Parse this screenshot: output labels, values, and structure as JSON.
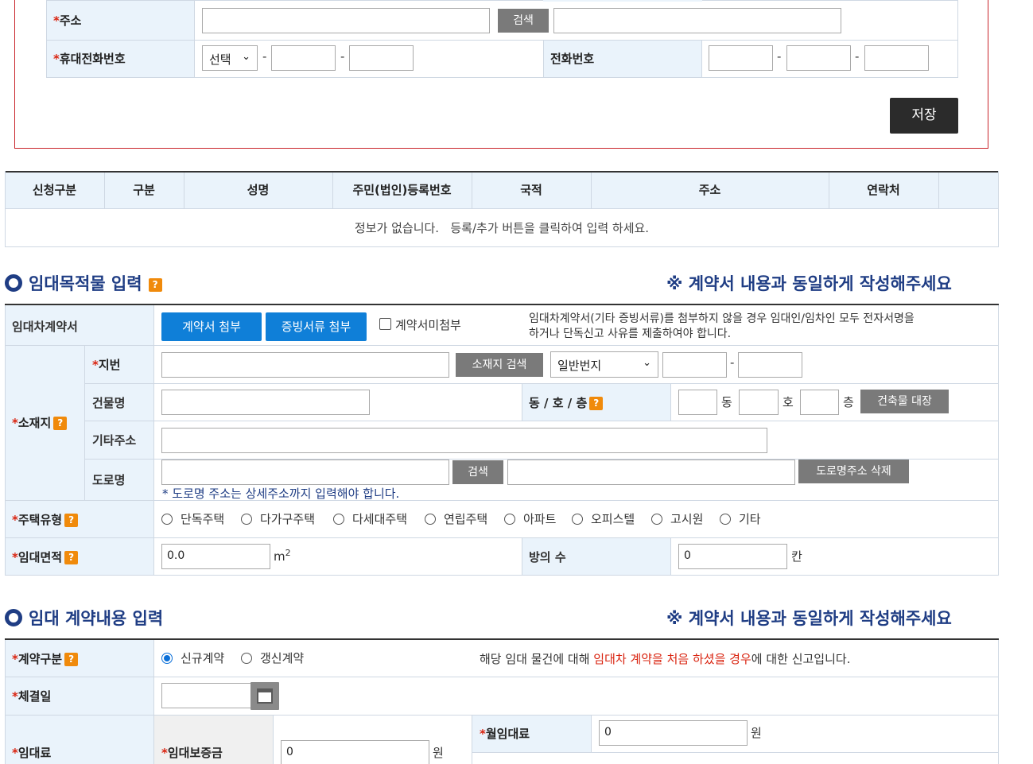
{
  "top_form": {
    "address_label": "주소",
    "address_search_button": "검색",
    "mobile_label": "휴대전화번호",
    "mobile_select": "선택",
    "dash": "-",
    "phone_label": "전화번호",
    "save_button": "저장"
  },
  "party_table": {
    "headers": [
      "신청구분",
      "구분",
      "성명",
      "주민(법인)등록번호",
      "국적",
      "주소",
      "연락처"
    ],
    "empty_message": "정보가 없습니다.   등록/추가 버튼을 클릭하여 입력 하세요."
  },
  "section1": {
    "title": "임대목적물 입력",
    "help": "?",
    "notice": "※ 계약서 내용과 동일하게 작성해주세요",
    "contract_doc_label": "임대차계약서",
    "attach_contract_button": "계약서 첨부",
    "attach_evidence_button": "증빙서류 첨부",
    "no_attach_checkbox": "계약서미첨부",
    "attach_note_line1": "임대차계약서(기타 증빙서류)를 첨부하지 않을 경우 임대인/임차인 모두 전자서명을",
    "attach_note_line2": "하거나 단독신고 사유를 제출하여야 합니다.",
    "location_label": "소재지",
    "lot_label": "지번",
    "location_search_button": "소재지 검색",
    "lot_type_select": "일반번지",
    "building_name_label": "건물명",
    "dong_ho_floor_label": "동 / 호 / 층",
    "dong_unit": "동",
    "ho_unit": "호",
    "floor_unit": "층",
    "building_registry_button": "건축물 대장",
    "other_address_label": "기타주소",
    "road_label": "도로명",
    "road_search_button": "검색",
    "road_delete_button": "도로명주소 삭제",
    "road_note": "* 도로명 주소는 상세주소까지 입력해야 합니다.",
    "housing_type_label": "주택유형",
    "housing_types": [
      "단독주택",
      "다가구주택",
      "다세대주택",
      "연립주택",
      "아파트",
      "오피스텔",
      "고시원",
      "기타"
    ],
    "area_label": "임대면적",
    "area_value": "0.0",
    "area_unit": "m",
    "area_unit_sup": "2",
    "rooms_label": "방의 수",
    "rooms_value": "0",
    "rooms_unit": "칸"
  },
  "section2": {
    "title": "임대 계약내용 입력",
    "notice": "※ 계약서 내용과 동일하게 작성해주세요",
    "contract_type_label": "계약구분",
    "contract_types": [
      "신규계약",
      "갱신계약"
    ],
    "contract_note_pre": "해당 임대 물건에 대해 ",
    "contract_note_red": "임대차 계약을 처음 하셨을 경우",
    "contract_note_post": "에 대한 신고입니다.",
    "conclusion_date_label": "체결일",
    "rent_label": "임대료",
    "deposit_label": "임대보증금",
    "deposit_value": "0",
    "won": "원",
    "monthly_rent_label": "월임대료",
    "monthly_rent_value": "0"
  },
  "colors": {
    "accent_blue": "#0f7fd8",
    "title_navy": "#1f3d84",
    "required_red": "#d9230f",
    "help_orange": "#f08a0b"
  }
}
